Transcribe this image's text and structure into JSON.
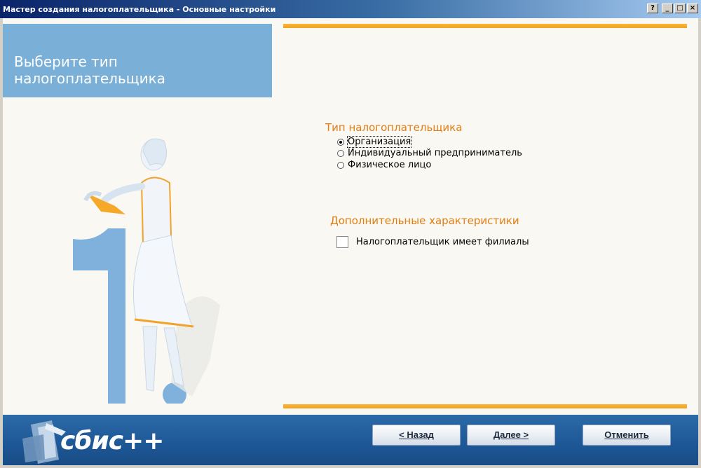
{
  "window": {
    "title": "Мастер создания налогоплательщика - Основные настройки",
    "buttons": {
      "help": "?",
      "minimize": "_",
      "maximize": "□",
      "close": "×"
    }
  },
  "header": {
    "title": "Выберите тип налогоплательщика",
    "color": "#7ab0d7"
  },
  "taxpayer_type": {
    "title": "Тип налогоплательщика",
    "options": [
      {
        "label": "Организация",
        "selected": true
      },
      {
        "label": "Индивидуальный предприниматель",
        "selected": false
      },
      {
        "label": "Физическое лицо",
        "selected": false
      }
    ]
  },
  "additional": {
    "title": "Дополнительные характеристики",
    "has_branches": {
      "label": "Налогоплательщик имеет филиалы",
      "checked": false
    }
  },
  "footer": {
    "logo_text": "сбис++",
    "back_label": "< Назад",
    "next_label": "Далее >",
    "cancel_label": "Отменить"
  },
  "colors": {
    "accent_orange": "#e27d14",
    "footer_blue": "#1d5796",
    "title_bar": "#0a246a"
  }
}
